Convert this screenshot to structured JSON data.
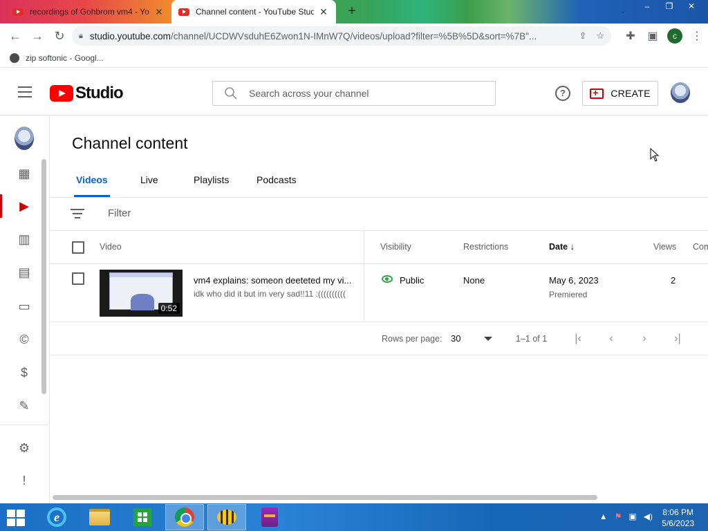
{
  "browser": {
    "tabs": [
      {
        "title": "recordings of Gohbrom vm4 - Yo",
        "active": false
      },
      {
        "title": "Channel content - YouTube Studio",
        "active": true
      }
    ],
    "new_tab_label": "+",
    "url_host": "studio.youtube.com",
    "url_path": "/channel/UCDWVsduhE6Zwon1N-IMnW7Q/videos/upload?filter=%5B%5D&sort=%7B\"...",
    "profile_initial": "c",
    "bookmarks": [
      {
        "label": "zip softonic - Googl..."
      }
    ],
    "window_controls": [
      "–",
      "❐",
      "✕"
    ]
  },
  "studio": {
    "logo_text": "Studio",
    "search_placeholder": "Search across your channel",
    "help_label": "?",
    "create_label": "CREATE",
    "page_title": "Channel content",
    "tabs": [
      {
        "label": "Videos",
        "active": true
      },
      {
        "label": "Live",
        "active": false
      },
      {
        "label": "Playlists",
        "active": false
      },
      {
        "label": "Podcasts",
        "active": false
      }
    ],
    "filter_placeholder": "Filter",
    "columns": {
      "video": "Video",
      "visibility": "Visibility",
      "restrictions": "Restrictions",
      "date": "Date",
      "date_sort_icon": "↓",
      "views": "Views",
      "comments": "Com"
    },
    "rows": [
      {
        "title": "vm4 explains: someon deeteted my vi...",
        "description": "idk who did it but im very sad!!11 :((((((((((",
        "duration": "0:52",
        "visibility": "Public",
        "restrictions": "None",
        "date": "May 6, 2023",
        "date_sub": "Premiered",
        "views": "2"
      }
    ],
    "pagination": {
      "rows_per_page_label": "Rows per page:",
      "rows_per_page": "30",
      "range": "1–1 of 1"
    },
    "sidebar_items": [
      {
        "name": "dashboard-icon",
        "glyph": "▦"
      },
      {
        "name": "content-icon",
        "glyph": "▶"
      },
      {
        "name": "analytics-icon",
        "glyph": "▥"
      },
      {
        "name": "comments-icon",
        "glyph": "▤"
      },
      {
        "name": "subtitles-icon",
        "glyph": "▭"
      },
      {
        "name": "copyright-icon",
        "glyph": "©"
      },
      {
        "name": "earn-icon",
        "glyph": "$"
      },
      {
        "name": "customization-icon",
        "glyph": "✎"
      },
      {
        "name": "settings-icon",
        "glyph": "⚙"
      },
      {
        "name": "feedback-icon",
        "glyph": "!"
      }
    ]
  },
  "taskbar": {
    "time": "8:06 PM",
    "date": "5/6/2023"
  },
  "colors": {
    "accent_blue": "#065fd4",
    "youtube_red": "#ff0000",
    "public_green": "#2ba640",
    "taskbar_blue": "#1a6fc4"
  }
}
